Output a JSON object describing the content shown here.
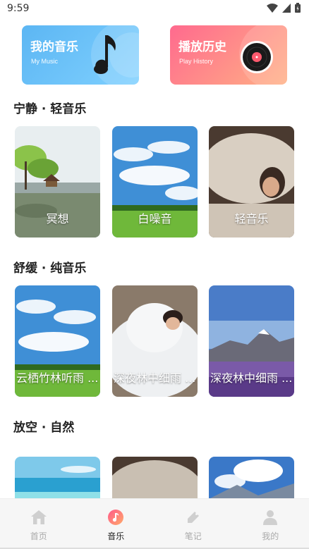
{
  "status": {
    "time": "9:59"
  },
  "cards": {
    "music": {
      "title": "我的音乐",
      "subtitle": "My Music"
    },
    "history": {
      "title": "播放历史",
      "subtitle": "Play History"
    }
  },
  "sections": [
    {
      "title": "宁静 · 轻音乐",
      "tiles": [
        "冥想",
        "白噪音",
        "轻音乐"
      ]
    },
    {
      "title": "舒缓 · 纯音乐",
      "tiles": [
        "云栖竹林听雨 ...",
        "深夜林中细雨 ...",
        "深夜林中细雨 ..."
      ]
    },
    {
      "title": "放空 · 自然",
      "tiles": [
        "",
        "",
        ""
      ]
    }
  ],
  "nav": [
    {
      "label": "首页",
      "icon": "home-icon",
      "active": false
    },
    {
      "label": "音乐",
      "icon": "music-icon",
      "active": true
    },
    {
      "label": "笔记",
      "icon": "note-icon",
      "active": false
    },
    {
      "label": "我的",
      "icon": "profile-icon",
      "active": false
    }
  ],
  "colors": {
    "music_card": "#5cb6f3",
    "history_card": "#ff6a8e",
    "active_nav": "#ff6a8e"
  }
}
